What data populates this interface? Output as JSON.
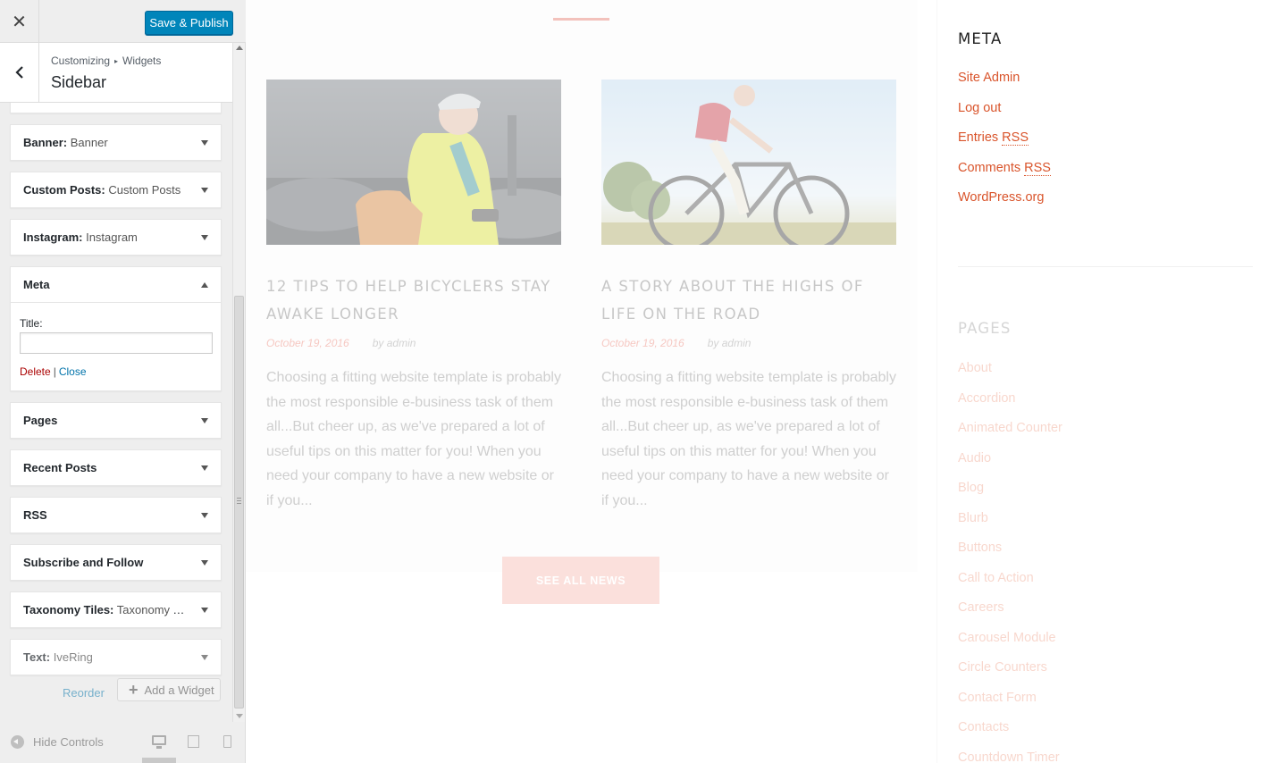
{
  "customizer": {
    "close_icon": "close-icon",
    "save_label": "Save & Publish",
    "breadcrumb": {
      "parent": "Customizing",
      "separator": "▸",
      "child": "Widgets"
    },
    "section_title": "Sidebar",
    "widgets": [
      {
        "type": "Banner:",
        "name": " Banner",
        "state": "collapsed"
      },
      {
        "type": "Custom Posts:",
        "name": " Custom Posts",
        "state": "collapsed"
      },
      {
        "type": "Instagram:",
        "name": " Instagram",
        "state": "collapsed"
      },
      {
        "type": "Meta",
        "name": "",
        "state": "expanded"
      },
      {
        "type": "Pages",
        "name": "",
        "state": "collapsed"
      },
      {
        "type": "Recent Posts",
        "name": "",
        "state": "collapsed"
      },
      {
        "type": "RSS",
        "name": "",
        "state": "collapsed"
      },
      {
        "type": "Subscribe and Follow",
        "name": "",
        "state": "collapsed"
      },
      {
        "type": "Taxonomy Tiles:",
        "name": " Taxonomy Til...",
        "state": "collapsed"
      },
      {
        "type": "Text:",
        "name": " IveRing",
        "state": "collapsed"
      }
    ],
    "meta_form": {
      "title_label": "Title:",
      "title_value": "",
      "delete_label": "Delete",
      "separator": "|",
      "close_label": "Close"
    },
    "reorder_label": "Reorder",
    "add_widget_label": "Add a Widget",
    "hide_controls_label": "Hide Controls",
    "devices": [
      "desktop",
      "tablet",
      "mobile"
    ],
    "active_device": "desktop"
  },
  "preview": {
    "posts": [
      {
        "title": "12 TIPS TO HELP BICYCLERS STAY AWAKE LONGER",
        "date": "October 19, 2016",
        "author": "by admin",
        "excerpt": "Choosing a fitting website template is probably the most responsible e-business task of them all...But cheer up, as we've prepared a lot of useful tips on this matter for you! When you need your company to have a new website or if you...",
        "image": "cyclist-in-yellow-jacket-with-smartphone"
      },
      {
        "title": "A STORY ABOUT THE HIGHS OF LIFE ON THE ROAD",
        "date": "October 19, 2016",
        "author": "by admin",
        "excerpt": "Choosing a fitting website template is probably the most responsible e-business task of them all...But cheer up, as we've prepared a lot of useful tips on this matter for you! When you need your company to have a new website or if you...",
        "image": "cyclist-riding-mountain-bike-under-sky"
      }
    ],
    "see_all_label": "SEE ALL NEWS",
    "meta_heading": "META",
    "meta_links": [
      {
        "text": "Site Admin",
        "abbr": ""
      },
      {
        "text": "Log out",
        "abbr": ""
      },
      {
        "text": "Entries ",
        "abbr": "RSS"
      },
      {
        "text": "Comments ",
        "abbr": "RSS"
      },
      {
        "text": "WordPress.org",
        "abbr": ""
      }
    ],
    "pages_heading": "PAGES",
    "pages_links": [
      "About",
      "Accordion",
      "Animated Counter",
      "Audio",
      "Blog",
      "Blurb",
      "Buttons",
      "Call to Action",
      "Careers",
      "Carousel Module",
      "Circle Counters",
      "Contact Form",
      "Contacts",
      "Countdown Timer"
    ]
  },
  "colors": {
    "accent_blue": "#0085ba",
    "link_orange": "#d9542b",
    "delete_red": "#aa0000",
    "close_blue": "#0073aa",
    "button_pink": "#fbe0dc"
  }
}
